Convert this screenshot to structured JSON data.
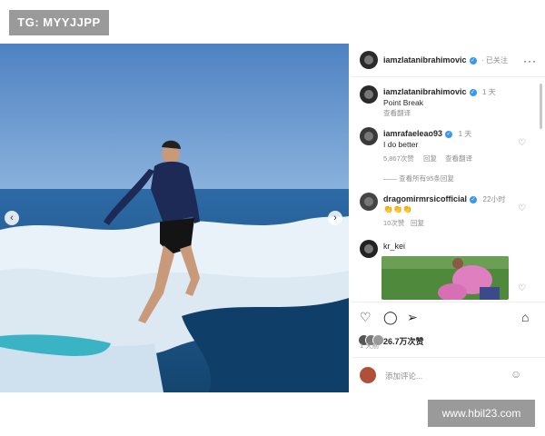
{
  "watermark_top": "TG: MYYJJPP",
  "watermark_bottom": "www.hbil23.com",
  "post": {
    "author": "iamzlatanibrahimovic",
    "follow_status": "· 已关注",
    "more_icon": "more-dots-icon",
    "caption": {
      "author": "iamzlatanibrahimovic",
      "time": "1 天",
      "text": "Point Break",
      "translate": "查看翻译"
    },
    "comments": [
      {
        "author": "iamrafaeleao93",
        "time": "1 天",
        "text": "I do better",
        "likes": "5,867次赞",
        "reply": "回复",
        "translate": "查看翻译",
        "view_replies": "—— 查看所有95条回复"
      },
      {
        "author": "dragomirmrsicofficial",
        "time": "22小时",
        "text": "👏👏👏",
        "likes": "10次赞",
        "reply": "回复"
      },
      {
        "author": "kr_kei"
      }
    ],
    "like_count": "26.7万次赞",
    "posted_ago": "1 天前",
    "comment_placeholder": "添加评论...",
    "colors": {
      "verified": "#3897f0",
      "muted": "#8e8e8e",
      "text": "#262626"
    }
  }
}
